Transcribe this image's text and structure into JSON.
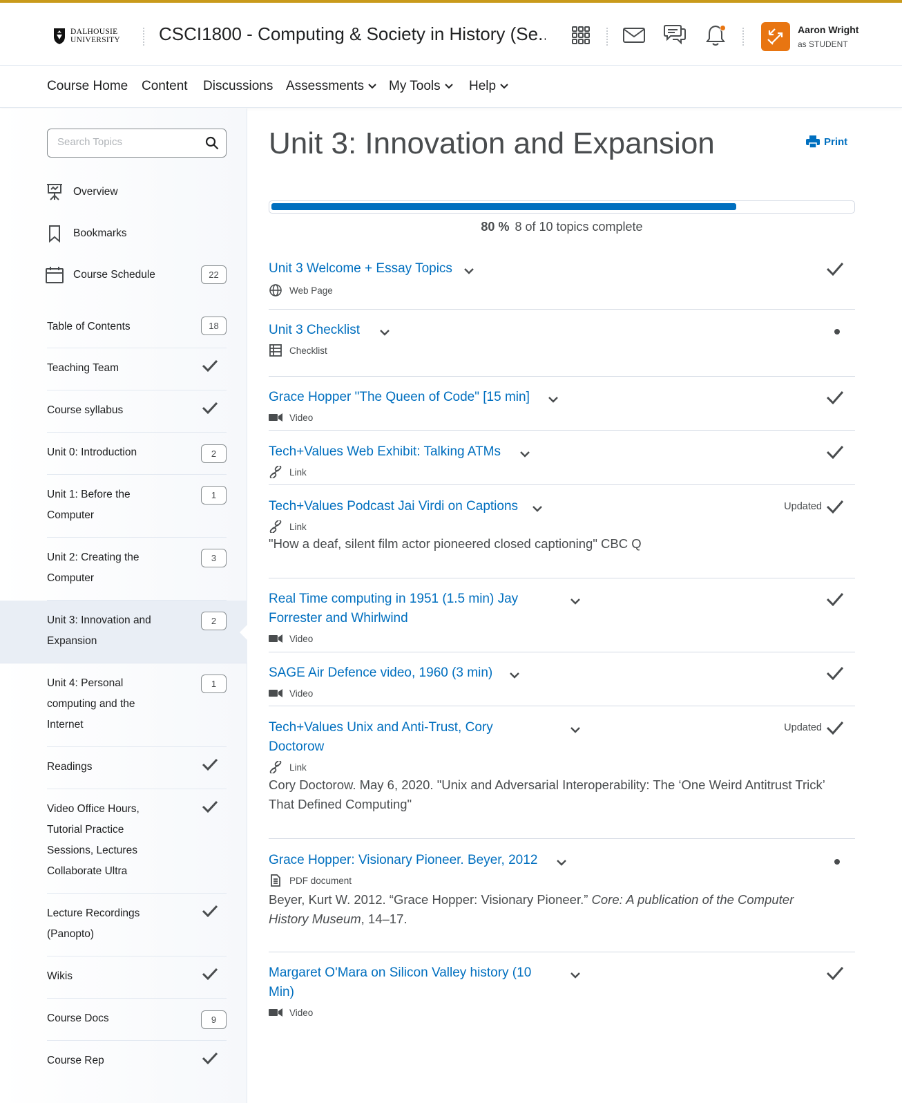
{
  "header": {
    "logo_text_1": "DALHOUSIE",
    "logo_text_2": "UNIVERSITY",
    "course_title": "CSCI1800 - Computing & Society in History (Se...",
    "user_name": "Aaron Wright",
    "user_role": "as STUDENT",
    "accent_color": "#c99a1a",
    "avatar_color": "#e87511"
  },
  "nav": {
    "items": [
      {
        "label": "Course Home",
        "dropdown": false
      },
      {
        "label": "Content",
        "dropdown": false
      },
      {
        "label": "Discussions",
        "dropdown": false
      },
      {
        "label": "Assessments",
        "dropdown": true
      },
      {
        "label": "My Tools",
        "dropdown": true
      },
      {
        "label": "Help",
        "dropdown": true
      }
    ]
  },
  "sidebar": {
    "search_placeholder": "Search Topics",
    "top_items": [
      {
        "label": "Overview",
        "icon": "presentation-icon"
      },
      {
        "label": "Bookmarks",
        "icon": "bookmark-icon"
      },
      {
        "label": "Course Schedule",
        "icon": "calendar-icon",
        "count": "22"
      }
    ],
    "modules": [
      {
        "label": "Table of Contents",
        "count": "18"
      },
      {
        "label": "Teaching Team",
        "status": "complete"
      },
      {
        "label": "Course syllabus",
        "status": "complete"
      },
      {
        "label": "Unit 0: Introduction",
        "count": "2"
      },
      {
        "label": "Unit 1: Before the Computer",
        "count": "1"
      },
      {
        "label": "Unit 2: Creating the Computer",
        "count": "3"
      },
      {
        "label": "Unit 3: Innovation and Expansion",
        "count": "2",
        "active": true
      },
      {
        "label": "Unit 4: Personal computing and the Internet",
        "count": "1"
      },
      {
        "label": "Readings",
        "status": "complete"
      },
      {
        "label": "Video Office Hours, Tutorial Practice Sessions, Lectures Collaborate Ultra",
        "status": "complete"
      },
      {
        "label": "Lecture Recordings (Panopto)",
        "status": "complete"
      },
      {
        "label": "Wikis",
        "status": "complete"
      },
      {
        "label": "Course Docs",
        "count": "9"
      },
      {
        "label": "Course Rep",
        "status": "complete"
      }
    ]
  },
  "main": {
    "title": "Unit 3: Innovation and Expansion",
    "print_label": "Print",
    "progress": {
      "percent_label": "80 %",
      "summary": "8 of 10 topics complete",
      "fraction": 0.8
    },
    "topics": [
      {
        "title": "Unit 3 Welcome + Essay Topics",
        "type": "Web Page",
        "icon": "globe-icon",
        "status": "complete"
      },
      {
        "title": "Unit 3 Checklist",
        "type": "Checklist",
        "icon": "checklist-icon",
        "status": "incomplete"
      },
      {
        "title": "Grace Hopper \"The Queen of Code\" [15 min]",
        "type": "Video",
        "icon": "video-icon",
        "status": "complete"
      },
      {
        "title": "Tech+Values Web Exhibit: Talking ATMs",
        "type": "Link",
        "icon": "link-icon",
        "status": "complete"
      },
      {
        "title": "Tech+Values Podcast Jai Virdi on Captions",
        "type": "Link",
        "icon": "link-icon",
        "status": "complete",
        "updated": "Updated",
        "description": "\"How a deaf, silent film actor pioneered closed captioning\" CBC Q"
      },
      {
        "title": "Real Time computing in 1951 (1.5 min) Jay Forrester and Whirlwind",
        "type": "Video",
        "icon": "video-icon",
        "status": "complete"
      },
      {
        "title": "SAGE Air Defence video, 1960 (3 min)",
        "type": "Video",
        "icon": "video-icon",
        "status": "complete"
      },
      {
        "title": "Tech+Values Unix and Anti-Trust, Cory Doctorow",
        "type": "Link",
        "icon": "link-icon",
        "status": "complete",
        "updated": "Updated",
        "description": "Cory Doctorow. May 6, 2020. \"Unix and Adversarial Interoperability: The ‘One Weird Antitrust Trick’ That Defined Computing\""
      },
      {
        "title": "Grace Hopper: Visionary Pioneer. Beyer, 2012",
        "type": "PDF document",
        "icon": "document-icon",
        "status": "incomplete",
        "description_parts": [
          "Beyer, Kurt W. 2012. “Grace Hopper: Visionary Pioneer.” ",
          "Core: A publication of the Computer History Museum",
          ", 14–17."
        ]
      },
      {
        "title": "Margaret O'Mara on Silicon Valley history (10 Min)",
        "type": "Video",
        "icon": "video-icon",
        "status": "complete"
      }
    ]
  }
}
